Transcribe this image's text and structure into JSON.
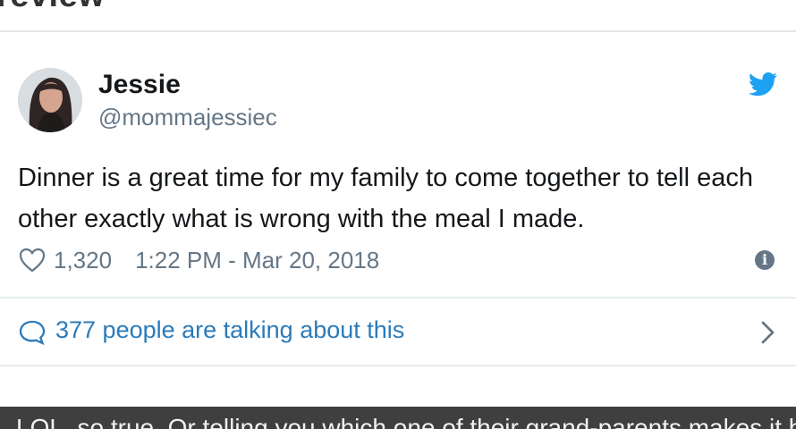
{
  "page": {
    "heading": "review"
  },
  "tweet": {
    "author_name": "Jessie",
    "author_handle": "@mommajessiec",
    "text": "Dinner is a great time for my family to come together to tell each other exactly what is wrong with the meal I made.",
    "likes": "1,320",
    "timestamp": "1:22 PM - Mar 20, 2018"
  },
  "conversation": {
    "label": "377 people are talking about this"
  },
  "comment_preview": {
    "text": "LOL, so true. Or telling you which one of their grand-parents makes it better."
  },
  "colors": {
    "text": "#14171a",
    "secondary": "#657786",
    "link": "#2b7bb9",
    "twitter_blue": "#1da1f2",
    "bottom_band": "#3f3f3f"
  },
  "icons": {
    "brand": "twitter-bird-icon",
    "like": "heart-icon",
    "info": "info-icon",
    "conversation": "speech-bubble-icon",
    "next": "chevron-right-icon"
  }
}
